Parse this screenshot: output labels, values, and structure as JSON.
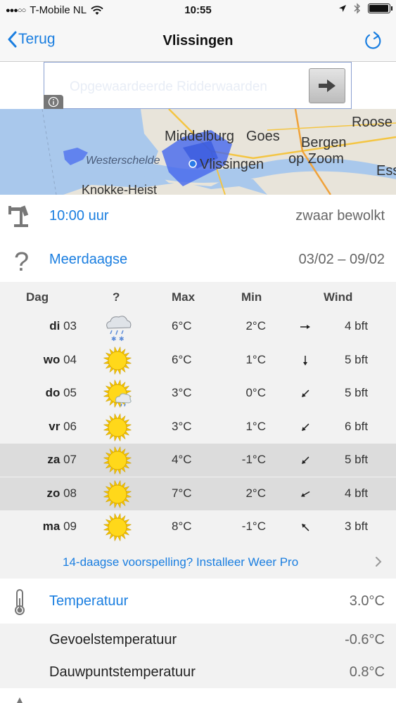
{
  "status": {
    "carrier": "T-Mobile NL",
    "time": "10:55"
  },
  "nav": {
    "back_label": "Terug",
    "title": "Vlissingen"
  },
  "ad": {
    "text": "Opgewaardeerde Ridderwaarden"
  },
  "map": {
    "labels": [
      "Middelburg",
      "Goes",
      "Roose",
      "Bergen",
      "op Zoom",
      "Westerschelde",
      "Vlissingen",
      "Ess",
      "Knokke-Heist"
    ]
  },
  "current": {
    "time_label": "10:00 uur",
    "condition": "zwaar bewolkt"
  },
  "multiday": {
    "label": "Meerdaagse",
    "range": "03/02 – 09/02"
  },
  "forecast": {
    "headers": {
      "day": "Dag",
      "icon": "?",
      "max": "Max",
      "min": "Min",
      "wind": "Wind"
    },
    "rows": [
      {
        "dayname": "di",
        "daynum": "03",
        "icon": "snow-rain-cloud-icon",
        "max": "6°C",
        "min": "2°C",
        "wind": "4 bft",
        "dir_deg": 90
      },
      {
        "dayname": "wo",
        "daynum": "04",
        "icon": "sun-icon",
        "max": "6°C",
        "min": "1°C",
        "wind": "5 bft",
        "dir_deg": 180
      },
      {
        "dayname": "do",
        "daynum": "05",
        "icon": "sun-cloud-icon",
        "max": "3°C",
        "min": "0°C",
        "wind": "5 bft",
        "dir_deg": 225
      },
      {
        "dayname": "vr",
        "daynum": "06",
        "icon": "sun-icon",
        "max": "3°C",
        "min": "1°C",
        "wind": "6 bft",
        "dir_deg": 225
      },
      {
        "dayname": "za",
        "daynum": "07",
        "icon": "sun-icon",
        "max": "4°C",
        "min": "-1°C",
        "wind": "5 bft",
        "dir_deg": 225
      },
      {
        "dayname": "zo",
        "daynum": "08",
        "icon": "sun-icon",
        "max": "7°C",
        "min": "2°C",
        "wind": "4 bft",
        "dir_deg": 240
      },
      {
        "dayname": "ma",
        "daynum": "09",
        "icon": "sun-icon",
        "max": "8°C",
        "min": "-1°C",
        "wind": "3 bft",
        "dir_deg": 315
      }
    ],
    "promo": "14-daagse voorspelling? Installeer Weer Pro"
  },
  "temperature": {
    "label": "Temperatuur",
    "value": "3.0°C",
    "feels_label": "Gevoelstemperatuur",
    "feels_value": "-0.6°C",
    "dew_label": "Dauwpuntstemperatuur",
    "dew_value": "0.8°C"
  },
  "colors": {
    "accent": "#1a7ee0",
    "shade_row": "#dcdcdc",
    "table_bg": "#f2f2f2"
  }
}
